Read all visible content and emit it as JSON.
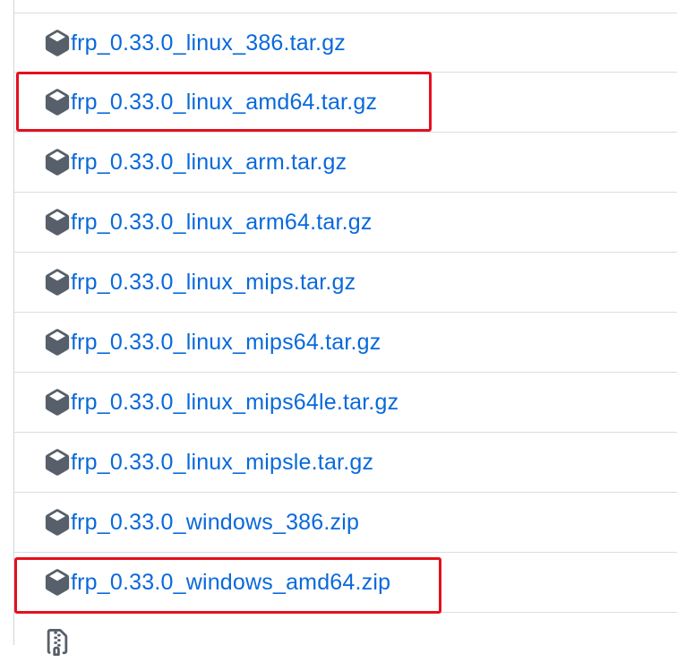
{
  "assets": {
    "files": [
      {
        "name": "frp_0.33.0_linux_386.tar.gz",
        "icon": "package-icon"
      },
      {
        "name": "frp_0.33.0_linux_amd64.tar.gz",
        "icon": "package-icon"
      },
      {
        "name": "frp_0.33.0_linux_arm.tar.gz",
        "icon": "package-icon"
      },
      {
        "name": "frp_0.33.0_linux_arm64.tar.gz",
        "icon": "package-icon"
      },
      {
        "name": "frp_0.33.0_linux_mips.tar.gz",
        "icon": "package-icon"
      },
      {
        "name": "frp_0.33.0_linux_mips64.tar.gz",
        "icon": "package-icon"
      },
      {
        "name": "frp_0.33.0_linux_mips64le.tar.gz",
        "icon": "package-icon"
      },
      {
        "name": "frp_0.33.0_linux_mipsle.tar.gz",
        "icon": "package-icon"
      },
      {
        "name": "frp_0.33.0_windows_386.zip",
        "icon": "package-icon"
      },
      {
        "name": "frp_0.33.0_windows_amd64.zip",
        "icon": "package-icon"
      }
    ],
    "partial_row_icon": "file-zip-icon"
  },
  "annotations": {
    "highlight_color": "#e5101e",
    "highlighted_files": [
      "frp_0.33.0_linux_amd64.tar.gz",
      "frp_0.33.0_windows_amd64.zip"
    ]
  },
  "colors": {
    "link": "#0969da",
    "icon": "#57606a",
    "border": "#d8dee4"
  }
}
